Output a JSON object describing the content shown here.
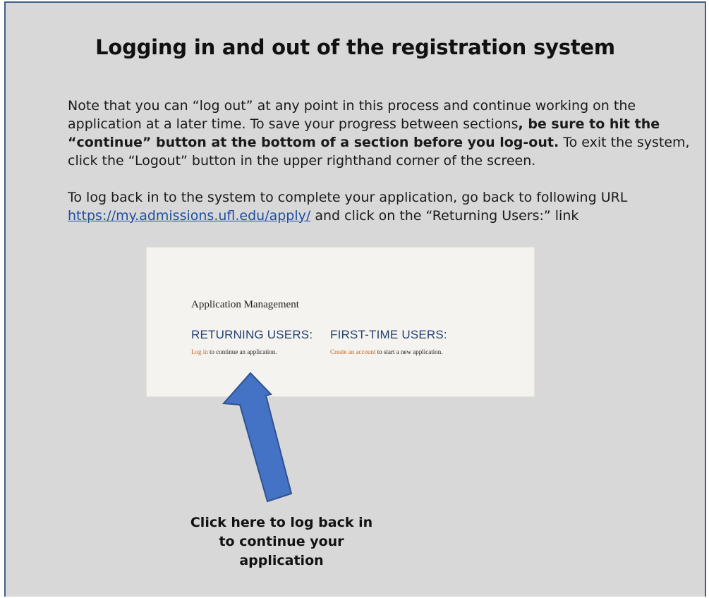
{
  "slide": {
    "title": "Logging in and out of the registration system",
    "paragraph1": {
      "part1": "Note that you can “log out” at any point in this process and continue working on the application at a later time.  To save your progress between sections",
      "bold": ", be sure to hit the “continue” button at the bottom of a section before you log-out.",
      "part2": " To exit the system, click the “Logout” button in the upper righthand corner of the screen."
    },
    "paragraph2": {
      "text": "To log back in to the system to complete your application, go back to following URL ",
      "url": "https://my.admissions.ufl.edu/apply/",
      "after": " and click on the “Returning Users:” link"
    },
    "screenshot": {
      "heading": "Application Management",
      "returning": {
        "title": "RETURNING USERS:",
        "link": "Log in",
        "text": " to continue an application."
      },
      "first_time": {
        "title": "FIRST-TIME USERS:",
        "link": "Create an account",
        "text": " to start a new application."
      }
    },
    "caption": [
      "Click here to log back in",
      "to continue your",
      "application"
    ],
    "arrow_color": "#4472c4",
    "link_color": "#1f4ea3",
    "accent_color": "#c8641f"
  }
}
